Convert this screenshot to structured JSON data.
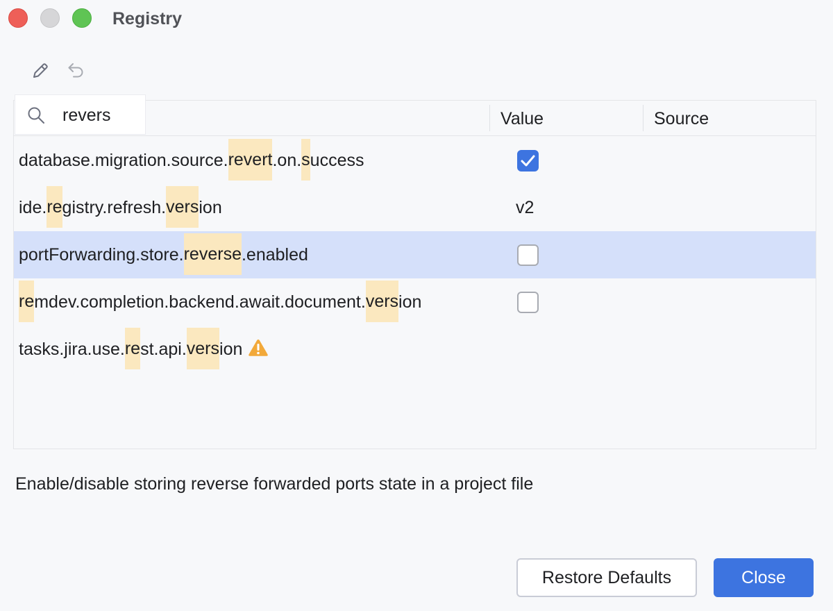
{
  "window": {
    "title": "Registry"
  },
  "colors": {
    "accent": "#3d74e0",
    "highlight": "#fbe8bf",
    "selected_row": "#d5e0fa",
    "warning": "#f2a93a"
  },
  "toolbar": {
    "icons": [
      "pencil-icon",
      "undo-icon"
    ]
  },
  "search": {
    "value": "revers",
    "placeholder": ""
  },
  "table": {
    "columns": [
      "Value",
      "Source"
    ],
    "rows": [
      {
        "key": [
          "database.migration.source.",
          "revert",
          ".on.",
          "s",
          "uccess"
        ],
        "highlighted": [
          false,
          true,
          false,
          true,
          false
        ],
        "value_type": "checkbox",
        "checked": true,
        "value": "",
        "source": ""
      },
      {
        "key": [
          "ide.",
          "re",
          "gistry.refresh.",
          "vers",
          "ion"
        ],
        "highlighted": [
          false,
          true,
          false,
          true,
          false
        ],
        "value_type": "text",
        "value": "v2",
        "source": ""
      },
      {
        "key": [
          "portForwarding.store.",
          "reverse",
          ".enabled"
        ],
        "highlighted": [
          false,
          true,
          false
        ],
        "value_type": "checkbox",
        "checked": false,
        "value": "",
        "source": "",
        "selected": true
      },
      {
        "key": [
          "re",
          "mdev.completion.backend.await.document.",
          "vers",
          "ion"
        ],
        "highlighted": [
          true,
          false,
          true,
          false
        ],
        "value_type": "checkbox",
        "checked": false,
        "value": "",
        "source": ""
      },
      {
        "key": [
          "tasks.jira.use.",
          "re",
          "st.api.",
          "vers",
          "ion"
        ],
        "highlighted": [
          false,
          true,
          false,
          true,
          false
        ],
        "value_type": "none",
        "value": "",
        "source": "",
        "warning_icon": "warning-icon"
      }
    ]
  },
  "description": "Enable/disable storing reverse forwarded ports state in a project file",
  "buttons": {
    "restore_label": "Restore Defaults",
    "close_label": "Close"
  }
}
